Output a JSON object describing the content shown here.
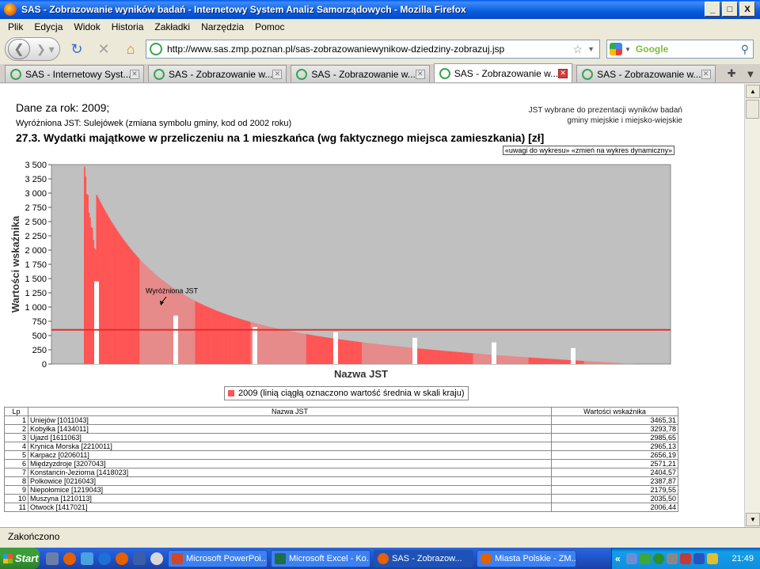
{
  "window": {
    "title": "SAS - Zobrazowanie wyników badań - Internetowy System Analiz Samorządowych - Mozilla Firefox",
    "min_label": "_",
    "max_label": "□",
    "close_label": "X"
  },
  "menu": [
    "Plik",
    "Edycja",
    "Widok",
    "Historia",
    "Zakładki",
    "Narzędzia",
    "Pomoc"
  ],
  "nav": {
    "url": "http://www.sas.zmp.poznan.pl/sas-zobrazowaniewynikow-dziedziny-zobrazuj.jsp",
    "search_placeholder": "Google"
  },
  "tabs": [
    {
      "label": "SAS - Internetowy Syst...",
      "active": false
    },
    {
      "label": "SAS - Zobrazowanie w...",
      "active": false
    },
    {
      "label": "SAS - Zobrazowanie w...",
      "active": false
    },
    {
      "label": "SAS - Zobrazowanie w...",
      "active": true
    },
    {
      "label": "SAS - Zobrazowanie w...",
      "active": false
    }
  ],
  "page": {
    "data_year": "Dane za rok: 2009;",
    "jst_highlight": "Wyróżniona JST: Sulejówek (zmiana symbolu gminy, kod od 2002 roku)",
    "right_info_1": "JST wybrane do prezentacji wyników badań",
    "right_info_2": "gminy miejskie i miejsko-wiejskie",
    "title": "27.3. Wydatki majątkowe w przeliczeniu na 1 mieszkańca (wg faktycznego miejsca zamieszkania) [zł]",
    "links": "«uwagi do wykresu» «zmień na wykres dynamiczny»",
    "legend": "2009   (linią ciągłą oznaczono wartość średnia w skali kraju)"
  },
  "chart_data": {
    "type": "bar",
    "ylabel": "Wartości wskaźnika",
    "xlabel": "Nazwa JST",
    "ylim": [
      0,
      3500
    ],
    "yticks": [
      "0",
      "250",
      "500",
      "750",
      "1 000",
      "1 250",
      "1 500",
      "1 750",
      "2 000",
      "2 250",
      "2 500",
      "2 750",
      "3 000",
      "3 250",
      "3 500"
    ],
    "average_line": 600,
    "annotation": "Wyróżniona JST",
    "annotation_value": 1000,
    "series": [
      {
        "name": "2009",
        "color": "#ff5555"
      }
    ],
    "first_values": [
      3465.31,
      3293.78,
      2985.65,
      2965.13,
      2656.19,
      2571.21,
      2404.57,
      2387.87,
      2179.55,
      2035.5,
      2006.44
    ]
  },
  "table": {
    "headers": [
      "Lp",
      "Nazwa JST",
      "Wartości wskaźnika"
    ],
    "rows": [
      [
        "1",
        "Uniejów [1011043]",
        "3465,31"
      ],
      [
        "2",
        "Kobyłka [1434011]",
        "3293,78"
      ],
      [
        "3",
        "Ujazd [1611063]",
        "2985,65"
      ],
      [
        "4",
        "Krynica Morska [2210011]",
        "2965,13"
      ],
      [
        "5",
        "Karpacz [0206011]",
        "2656,19"
      ],
      [
        "6",
        "Międzyzdroje [3207043]",
        "2571,21"
      ],
      [
        "7",
        "Konstancin-Jeziorna [1418023]",
        "2404,57"
      ],
      [
        "8",
        "Polkowice [0216043]",
        "2387,87"
      ],
      [
        "9",
        "Niepołomice [1219043]",
        "2179,55"
      ],
      [
        "10",
        "Muszyna [1210113]",
        "2035,50"
      ],
      [
        "11",
        "Otwock [1417021]",
        "2006,44"
      ]
    ]
  },
  "status": "Zakończono",
  "taskbar": {
    "start": "Start",
    "tasks": [
      {
        "label": "Microsoft PowerPoi...",
        "color": "#d24726"
      },
      {
        "label": "Microsoft Excel - Ko...",
        "color": "#1d7044"
      },
      {
        "label": "SAS - Zobrazow...",
        "color": "#e66000"
      },
      {
        "label": "Miasta Polskie - ZM...",
        "color": "#e66000"
      }
    ],
    "tray_arrow": "«",
    "clock": "21:49"
  }
}
